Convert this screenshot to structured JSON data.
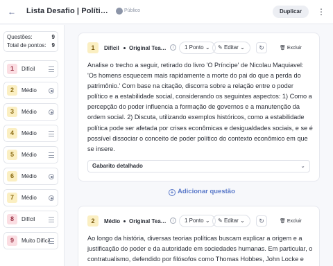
{
  "header": {
    "back_icon": "arrow-left-icon",
    "title": "Lista Desafio | Política e Poder",
    "visibility": "Público",
    "duplicate_label": "Duplicar",
    "more_icon": "kebab-icon"
  },
  "summary": {
    "questions_label": "Questões:",
    "questions_value": "9",
    "points_label": "Total de pontos:",
    "points_value": "9"
  },
  "sidebar": {
    "items": [
      {
        "num": "1",
        "label": "Difícil",
        "icon": "lines-icon",
        "color": "pink"
      },
      {
        "num": "2",
        "label": "Médio",
        "icon": "radio-icon",
        "color": "yellow"
      },
      {
        "num": "3",
        "label": "Médio",
        "icon": "radio-icon",
        "color": "yellow"
      },
      {
        "num": "4",
        "label": "Médio",
        "icon": "lines-icon",
        "color": "yellow"
      },
      {
        "num": "5",
        "label": "Médio",
        "icon": "lines-icon",
        "color": "yellow"
      },
      {
        "num": "6",
        "label": "Médio",
        "icon": "radio-icon",
        "color": "yellow"
      },
      {
        "num": "7",
        "label": "Médio",
        "icon": "radio-icon",
        "color": "yellow"
      },
      {
        "num": "8",
        "label": "Difícil",
        "icon": "lines-icon",
        "color": "pink"
      },
      {
        "num": "9",
        "label": "Muito Difícil",
        "icon": "lines-icon",
        "color": "pink"
      }
    ]
  },
  "questions": [
    {
      "num": "1",
      "difficulty": "Difícil",
      "source": "Original Teacher",
      "points": "1 Ponto",
      "edit_label": "Editar",
      "delete_label": "Excluir",
      "text": "Analise o trecho a seguir, retirado do livro 'O Príncipe' de Nicolau Maquiavel: 'Os homens esquecem mais rapidamente a morte do pai do que a perda do patrimônio.' Com base na citação, discorra sobre a relação entre o poder político e a estabilidade social, considerando os seguintes aspectos: 1) Como a percepção do poder influencia a formação de governos e a manutenção da ordem social. 2) Discuta, utilizando exemplos históricos, como a estabilidade política pode ser afetada por crises econômicas e desigualdades sociais, e se é possível dissociar o conceito de poder político do contexto econômico em que se insere.",
      "answer_label": "Gabarito detalhado"
    },
    {
      "num": "2",
      "difficulty": "Médio",
      "source": "Original Teacher",
      "points": "1 Ponto",
      "edit_label": "Editar",
      "delete_label": "Excluir",
      "text": "Ao longo da história, diversas teorias políticas buscam explicar a origem e a justificação do poder e da autoridade em sociedades humanas. Em particular, o contratualismo, defendido por filósofos como Thomas Hobbes, John Locke e"
    }
  ],
  "add_question_label": "Adicionar questão"
}
